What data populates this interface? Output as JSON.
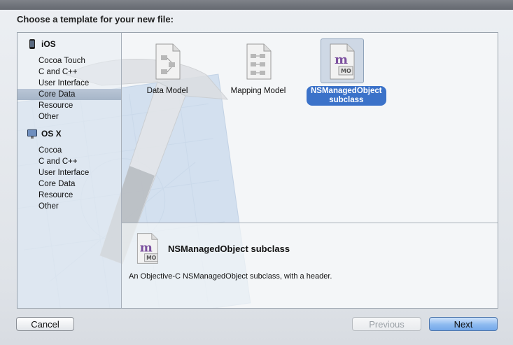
{
  "dialog": {
    "title": "Choose a template for your new file:"
  },
  "sidebar": {
    "groups": [
      {
        "label": "iOS",
        "icon": "iphone-icon",
        "items": [
          "Cocoa Touch",
          "C and C++",
          "User Interface",
          "Core Data",
          "Resource",
          "Other"
        ]
      },
      {
        "label": "OS X",
        "icon": "osx-icon",
        "items": [
          "Cocoa",
          "C and C++",
          "User Interface",
          "Core Data",
          "Resource",
          "Other"
        ]
      }
    ],
    "selected": "iOS / Core Data"
  },
  "templates": [
    {
      "label": "Data Model",
      "icon": "data-model-icon"
    },
    {
      "label": "Mapping Model",
      "icon": "mapping-model-icon"
    },
    {
      "label_line1": "NSManagedObject",
      "label_line2": "subclass",
      "icon": "managed-object-icon",
      "selected": true
    }
  ],
  "detail": {
    "title": "NSManagedObject subclass",
    "description": "An Objective-C NSManagedObject subclass, with a header.",
    "icon_letter": "m",
    "icon_badge": "MO"
  },
  "buttons": {
    "cancel": "Cancel",
    "previous": "Previous",
    "next": "Next"
  },
  "colors": {
    "selection": "#3b72c9",
    "sidebar_selection": "#a6b5c8"
  }
}
